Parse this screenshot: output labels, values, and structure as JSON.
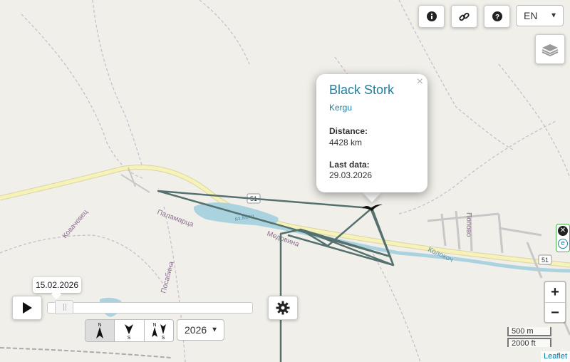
{
  "top_controls": {
    "info_icon": "info-icon",
    "link_icon": "link-icon",
    "help_icon": "help-icon",
    "language": "EN"
  },
  "layers_icon": "layers-icon",
  "popup": {
    "title": "Black Stork",
    "name": "Kergu",
    "distance_label": "Distance:",
    "distance_value": "4428 km",
    "last_data_label": "Last data:",
    "last_data_value": "29.03.2026",
    "close": "×"
  },
  "timeline": {
    "date_tooltip": "15.02.2026",
    "year": "2026",
    "progress": 0.04
  },
  "map_labels": {
    "road_51_a": "51",
    "road_51_b": "51",
    "palamartsa": "Паламарца",
    "kovachevets": "Ковачевец",
    "medovina": "Медовина",
    "posabina": "Посабина",
    "kolokoch": "Колокоч",
    "popovo": "Попово",
    "reservoir": "яз.Котл"
  },
  "zoom": {
    "in": "+",
    "out": "−"
  },
  "scale": {
    "metric": "500 m",
    "imperial": "2000 ft"
  },
  "attribution": "Leaflet",
  "colors": {
    "track": "#55716f",
    "water": "#aad3df",
    "road": "#f7f3b8",
    "accent": "#1e7ea1"
  }
}
